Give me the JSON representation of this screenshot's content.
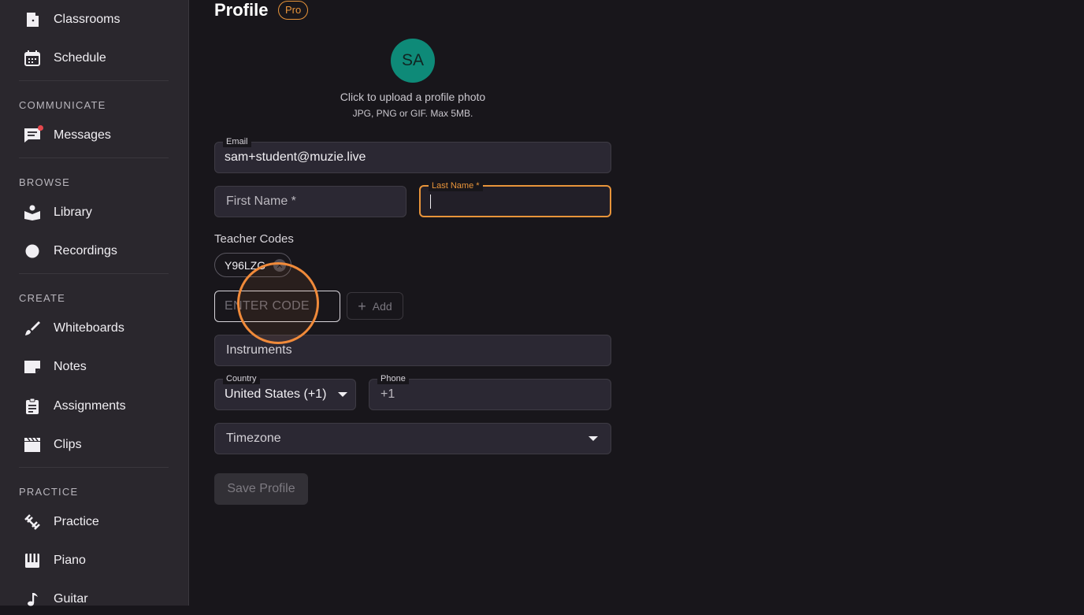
{
  "sidebar": {
    "items_top": [
      {
        "label": "Classrooms",
        "icon": "door-icon"
      },
      {
        "label": "Schedule",
        "icon": "calendar-icon"
      }
    ],
    "sections": [
      {
        "label": "COMMUNICATE",
        "items": [
          {
            "label": "Messages",
            "icon": "message-icon",
            "has_badge": true
          }
        ]
      },
      {
        "label": "BROWSE",
        "items": [
          {
            "label": "Library",
            "icon": "library-icon"
          },
          {
            "label": "Recordings",
            "icon": "record-icon"
          }
        ]
      },
      {
        "label": "CREATE",
        "items": [
          {
            "label": "Whiteboards",
            "icon": "brush-icon"
          },
          {
            "label": "Notes",
            "icon": "note-icon"
          },
          {
            "label": "Assignments",
            "icon": "clipboard-icon"
          },
          {
            "label": "Clips",
            "icon": "clapperboard-icon"
          }
        ]
      },
      {
        "label": "PRACTICE",
        "items": [
          {
            "label": "Practice",
            "icon": "dumbbell-icon"
          },
          {
            "label": "Piano",
            "icon": "piano-icon"
          },
          {
            "label": "Guitar",
            "icon": "music-note-icon"
          }
        ]
      }
    ]
  },
  "header": {
    "title": "Profile",
    "badge": "Pro"
  },
  "avatar": {
    "initials": "SA",
    "upload_hint": "Click to upload a profile photo",
    "upload_formats": "JPG, PNG or GIF. Max 5MB."
  },
  "form": {
    "email_label": "Email",
    "email_value": "sam+student@muzie.live",
    "first_name_placeholder": "First Name *",
    "last_name_label": "Last Name *",
    "last_name_value": "",
    "teacher_codes_title": "Teacher Codes",
    "teacher_codes": [
      "Y96LZG"
    ],
    "code_input_placeholder": "ENTER CODE",
    "add_label": "Add",
    "instruments_placeholder": "Instruments",
    "country_label": "Country",
    "country_value": "United States (+1)",
    "phone_label": "Phone",
    "phone_value": "+1",
    "timezone_placeholder": "Timezone",
    "save_label": "Save Profile"
  },
  "colors": {
    "accent": "#e8943a",
    "avatar": "#0e8a78",
    "background": "#18161b",
    "sidebar": "#2a272d"
  }
}
